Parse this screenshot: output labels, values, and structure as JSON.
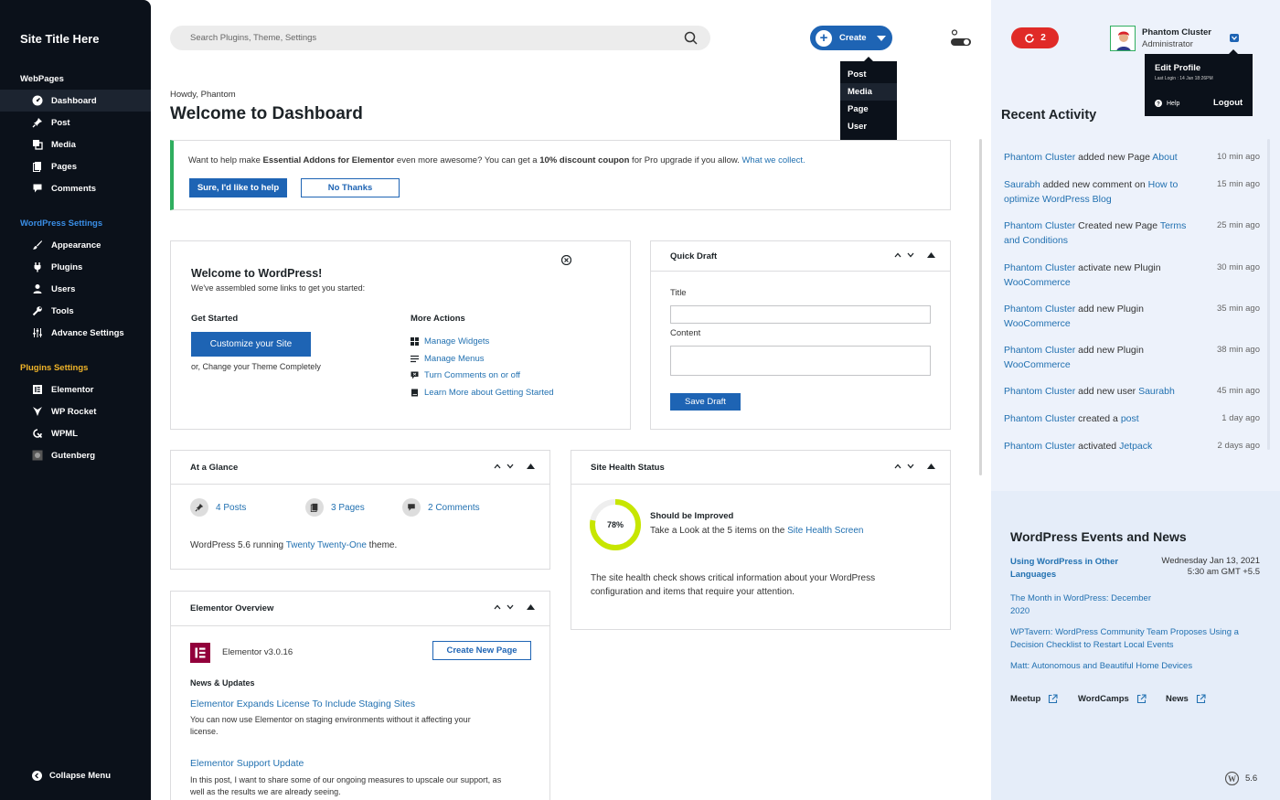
{
  "sidebar": {
    "site_title": "Site Title Here",
    "sections": [
      {
        "label": "WebPages",
        "color": "#ffffff"
      },
      {
        "label": "WordPress Settings",
        "color": "#3a8ee6"
      },
      {
        "label": "Plugins Settings",
        "color": "#f0b429"
      }
    ],
    "items": [
      {
        "label": "Dashboard",
        "icon": "dashboard-icon"
      },
      {
        "label": "Post",
        "icon": "pin-icon"
      },
      {
        "label": "Media",
        "icon": "media-icon"
      },
      {
        "label": "Pages",
        "icon": "pages-icon"
      },
      {
        "label": "Comments",
        "icon": "comment-icon"
      },
      {
        "label": "Appearance",
        "icon": "brush-icon"
      },
      {
        "label": "Plugins",
        "icon": "plugin-icon"
      },
      {
        "label": "Users",
        "icon": "user-icon"
      },
      {
        "label": "Tools",
        "icon": "wrench-icon"
      },
      {
        "label": "Advance Settings",
        "icon": "sliders-icon"
      },
      {
        "label": "Elementor",
        "icon": "elementor-icon"
      },
      {
        "label": "WP Rocket",
        "icon": "rocket-icon"
      },
      {
        "label": "WPML",
        "icon": "wpml-icon"
      },
      {
        "label": "Gutenberg",
        "icon": "gutenberg-icon"
      }
    ],
    "collapse_label": "Collapse Menu"
  },
  "topbar": {
    "search_placeholder": "Search Plugins, Theme, Settings",
    "create_label": "Create",
    "create_menu": [
      "Post",
      "Media",
      "Page",
      "User"
    ],
    "updates_count": "2"
  },
  "user": {
    "name": "Phantom Cluster",
    "role": "Administrator",
    "menu": {
      "edit_profile": "Edit Profile",
      "last_login": "Last Login : 14 Jan 18:26PM",
      "help": "Help",
      "logout": "Logout"
    }
  },
  "main": {
    "howdy": "Howdy, Phantom",
    "title": "Welcome to Dashboard",
    "notice": {
      "t1": "Want to help make ",
      "t2": "Essential Addons for Elementor",
      "t3": " even more awesome? You can get a ",
      "t4": "10% discount coupon",
      "t5": " for Pro upgrade if you allow. ",
      "link": "What we collect.",
      "accept": "Sure, I'd like to help",
      "decline": "No Thanks"
    },
    "welcome_panel": {
      "title": "Welcome to WordPress!",
      "subtitle": "We've assembled some links to get you started:",
      "get_started": "Get Started",
      "customize": "Customize your Site",
      "change_theme": "or, Change your Theme Completely",
      "more_actions": "More Actions",
      "actions": [
        "Manage Widgets",
        "Manage Menus",
        "Turn Comments on or off",
        "Learn More about Getting Started"
      ]
    },
    "quick_draft": {
      "title": "Quick Draft",
      "title_label": "Title",
      "content_label": "Content",
      "save": "Save Draft"
    },
    "glance": {
      "title": "At a Glance",
      "posts": "4 Posts",
      "pages": "3 Pages",
      "comments": "2 Comments",
      "t1": "WordPress 5.6 running ",
      "theme": "Twenty Twenty-One",
      "t2": " theme."
    },
    "health": {
      "title": "Site Health Status",
      "percent": "78%",
      "progress": 0.78,
      "status": "Should be Improved",
      "t1": "Take a Look at the 5 items on the ",
      "link": "Site Health Screen",
      "desc1": "The site health check shows critical information about your WordPress",
      "desc2": "configuration and items that require your attention.",
      "color": "#c7e600"
    },
    "elementor": {
      "title": "Elementor Overview",
      "version": "Elementor v3.0.16",
      "create": "Create New Page",
      "news_label": "News & Updates",
      "n1_title": "Elementor Expands License To Include Staging Sites",
      "n1_desc1": "You can now use Elementor on staging environments without it affecting your",
      "n1_desc2": "license.",
      "n2_title": "Elementor Support Update",
      "n2_desc1": "In this post, I want to share some of our ongoing measures to upscale our support, as",
      "n2_desc2": "well as the results we are already seeing."
    }
  },
  "recent": {
    "title": "Recent Activity",
    "items": [
      {
        "p1": "Phantom Cluster",
        "p2": " added new Page ",
        "p3": "About",
        "time": "10 min ago"
      },
      {
        "p1": "Saurabh",
        "p2": " added new comment on ",
        "p3": "How to optimize WordPress Blog",
        "time": "15 min ago"
      },
      {
        "p1": "Phantom Cluster",
        "p2": " Created new Page ",
        "p3": "Terms and Conditions",
        "time": "25 min ago"
      },
      {
        "p1": "Phantom Cluster",
        "p2": " activate new Plugin ",
        "p3": "WooCommerce",
        "time": "30 min ago"
      },
      {
        "p1": "Phantom Cluster",
        "p2": " add new Plugin ",
        "p3": "WooCommerce",
        "time": "35 min ago"
      },
      {
        "p1": "Phantom Cluster",
        "p2": " add new Plugin ",
        "p3": "WooCommerce",
        "time": "38 min ago"
      },
      {
        "p1": "Phantom Cluster",
        "p2": " add new user ",
        "p3": "Saurabh",
        "time": "45 min ago"
      },
      {
        "p1": "Phantom Cluster",
        "p2": " created a ",
        "p3": "post",
        "time": "1 day ago"
      },
      {
        "p1": "Phantom Cluster",
        "p2": " activated ",
        "p3": "Jetpack",
        "time": "2 days ago"
      }
    ]
  },
  "events": {
    "title": "WordPress Events and News",
    "e1": "Using WordPress in Other Languages",
    "e1_date": "Wednesday Jan 13, 2021",
    "e1_time": "5:30 am GMT +5.5",
    "n1": "The Month in WordPress: December 2020",
    "n2": "WPTavern: WordPress Community Team Proposes Using a Decision Checklist to Restart Local Events",
    "n3": "Matt: Autonomous and Beautiful Home Devices",
    "links": [
      "Meetup",
      "WordCamps",
      "News"
    ]
  },
  "wp_version": "5.6"
}
